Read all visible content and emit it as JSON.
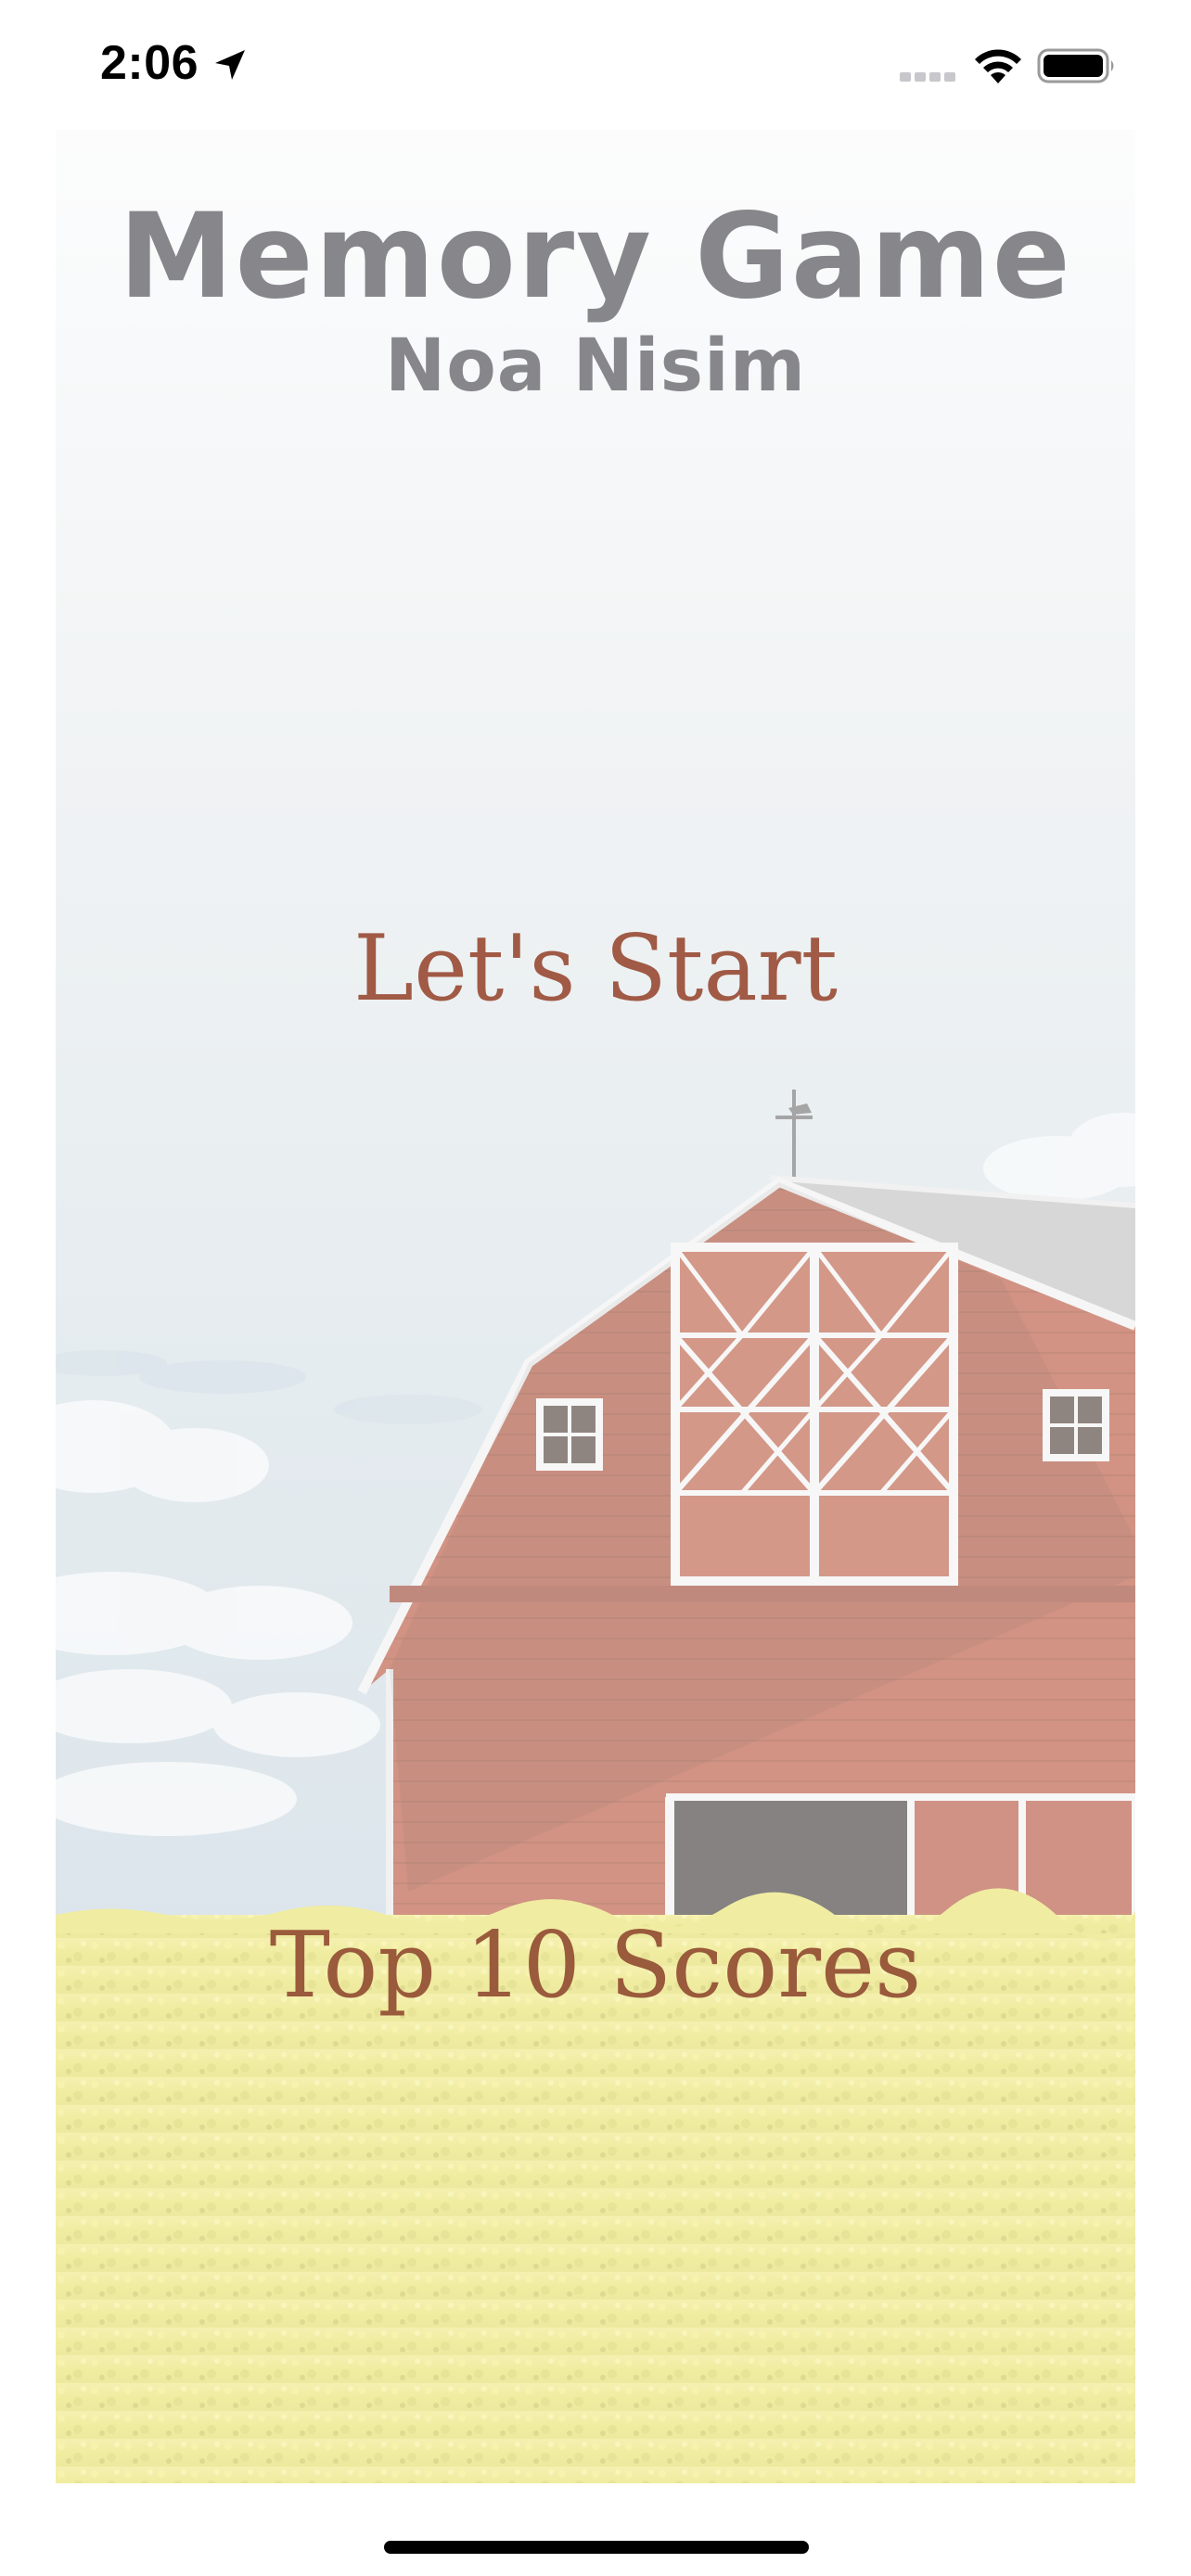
{
  "status_bar": {
    "time": "2:06",
    "icons": [
      "location-arrow-icon",
      "cellular-signal-icon",
      "wifi-icon",
      "battery-icon"
    ]
  },
  "header": {
    "title": "Memory Game",
    "subtitle": "Noa Nisim"
  },
  "menu": {
    "start_label": "Let's Start",
    "scores_label": "Top 10 Scores"
  },
  "colors": {
    "title": "#86868b",
    "button_text": "#a05a45",
    "sky": "#dfe6ea",
    "barn": "#b4503a",
    "field": "#e9e56a"
  }
}
